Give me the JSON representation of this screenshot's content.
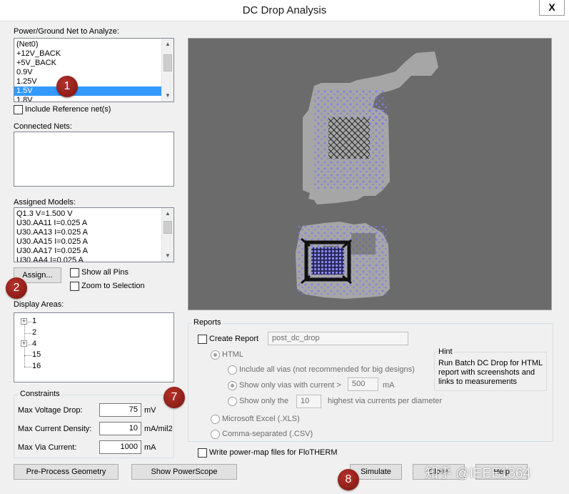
{
  "window": {
    "title": "DC Drop Analysis",
    "close_glyph": "X"
  },
  "net_select": {
    "label": "Power/Ground Net to Analyze:",
    "items": [
      "(Net0)",
      "+12V_BACK",
      "+5V_BACK",
      "0.9V",
      "1.25V",
      "1.5V",
      "1.8V"
    ],
    "selected": "1.5V",
    "include_ref_label": "Include Reference net(s)"
  },
  "connected_nets": {
    "label": "Connected Nets:"
  },
  "assigned_models": {
    "label": "Assigned Models:",
    "items": [
      "Q1.3 V=1.500 V",
      "U30.AA11 I=0.025 A",
      "U30.AA13 I=0.025 A",
      "U30.AA15 I=0.025 A",
      "U30.AA17 I=0.025 A",
      "U30.AA4 I=0.025 A"
    ],
    "assign_button": "Assign...",
    "show_all_pins": "Show all Pins",
    "zoom_to_selection": "Zoom to Selection"
  },
  "display_areas": {
    "label": "Display Areas:",
    "nodes": [
      "1",
      "2",
      "4",
      "15",
      "16"
    ],
    "expand_glyph": "+"
  },
  "constraints": {
    "title": "Constraints",
    "rows": [
      {
        "label": "Max Voltage Drop:",
        "value": "75",
        "unit": "mV"
      },
      {
        "label": "Max Current Density:",
        "value": "10",
        "unit": "mA/mil2"
      },
      {
        "label": "Max Via Current:",
        "value": "1000",
        "unit": "mA"
      }
    ]
  },
  "reports": {
    "title": "Reports",
    "create_report": "Create Report",
    "report_name": "post_dc_drop",
    "html": "HTML",
    "include_all_vias": "Include all vias (not recommended for big designs)",
    "show_only_vias": "Show only vias with current >",
    "via_current_value": "500",
    "via_current_unit": "mA",
    "show_only_the": "Show only the",
    "highest_value": "10",
    "highest_text": "highest via currents per diameter",
    "excel": "Microsoft Excel (.XLS)",
    "csv": "Comma-separated (.CSV)",
    "hint_title": "Hint",
    "hint_text": "Run Batch DC Drop for HTML report with screenshots and links to measurements"
  },
  "flotherm_label": "Write power-map files for FloTHERM",
  "bottom_buttons": {
    "preprocess": "Pre-Process Geometry",
    "powerscope": "Show PowerScope",
    "simulate": "Simulate",
    "close": "Close",
    "help": "Help"
  },
  "annotations": [
    "1",
    "2",
    "7",
    "8"
  ],
  "watermark": "知乎 @IEEE1364",
  "colors": {
    "selection": "#3399ff",
    "badge": "#8b1a14",
    "preview_bg": "#6b6b6b",
    "board": "#a6a6a6",
    "vias": "#7b78e8"
  }
}
